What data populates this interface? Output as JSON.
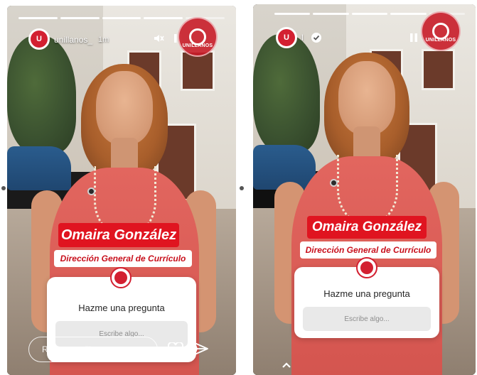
{
  "left_story": {
    "username": "unillanos_",
    "time": "1m",
    "avatar_text": "U",
    "brand_stamp_text": "UNILLANOS",
    "name_plate": "Omaira González",
    "role_plate": "Dirección General de Currículo",
    "question_sticker": {
      "title": "Hazme una pregunta",
      "placeholder": "Escribe algo..."
    },
    "reply_placeholder": "Reply to unillanos_...",
    "icons": {
      "mute": "mute-icon",
      "pause": "pause-icon",
      "heart": "heart-icon",
      "send": "send-icon"
    }
  },
  "right_story": {
    "username": "l",
    "avatar_text": "U",
    "brand_stamp_text": "UNILLANOS",
    "name_plate": "Omaira González",
    "role_plate": "Dirección General de Currículo",
    "question_sticker": {
      "title": "Hazme una pregunta",
      "placeholder": "Escribe algo..."
    },
    "icons": {
      "verified": "verified-icon",
      "pause": "pause-icon",
      "mute": "mute-icon",
      "caret_up": "chevron-up-icon"
    }
  },
  "colors": {
    "brand_red": "#e01420",
    "white": "#ffffff",
    "sticker_input_bg": "#e9e9e9"
  }
}
